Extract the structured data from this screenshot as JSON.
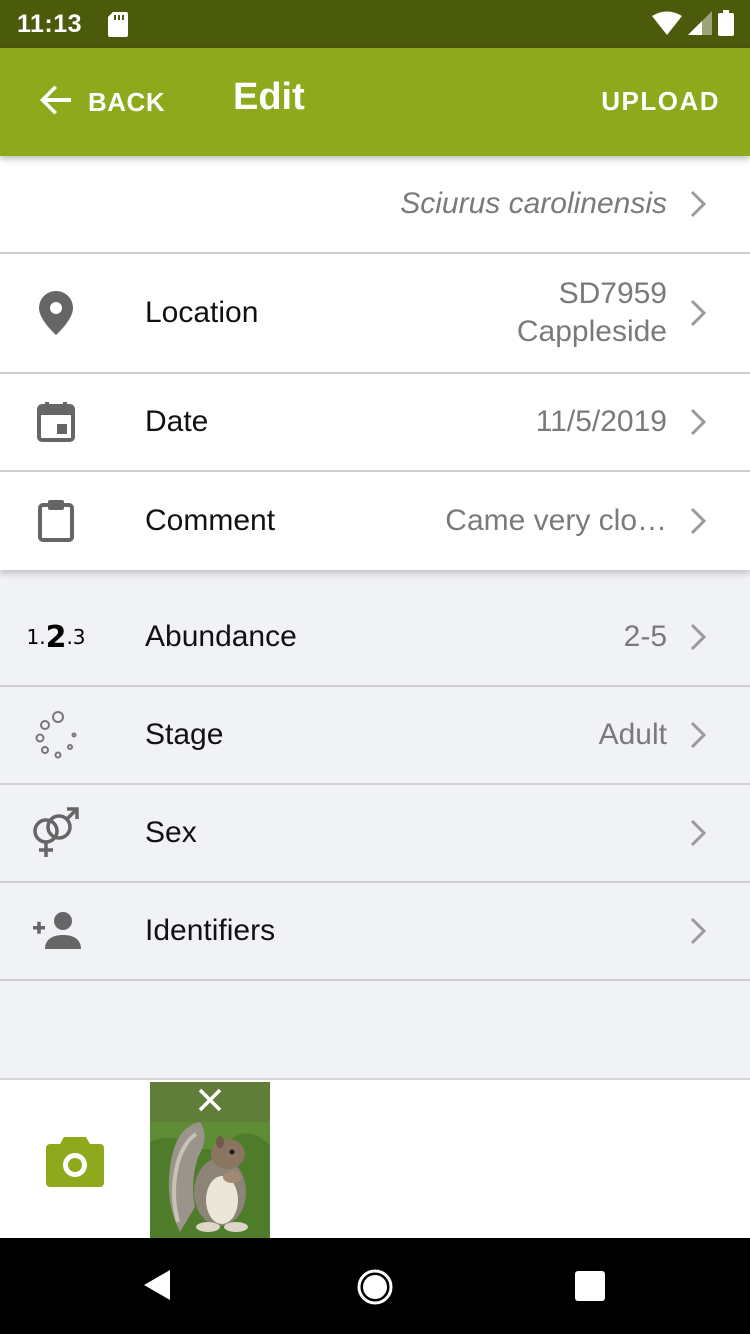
{
  "status_bar": {
    "time": "11:13",
    "icons": [
      "sd-card-icon",
      "wifi-icon",
      "signal-icon",
      "battery-icon"
    ]
  },
  "app_bar": {
    "back_label": "BACK",
    "title": "Edit",
    "upload_label": "UPLOAD",
    "color": "#8fa91c"
  },
  "record": {
    "species": "Sciurus carolinensis",
    "location": {
      "label": "Location",
      "value_line1": "SD7959",
      "value_line2": "Cappleside"
    },
    "date": {
      "label": "Date",
      "value": "11/5/2019"
    },
    "comment": {
      "label": "Comment",
      "value": "Came very clo…"
    }
  },
  "attributes": [
    {
      "label": "Abundance",
      "value": "2-5",
      "icon": "abundance-icon"
    },
    {
      "label": "Stage",
      "value": "Adult",
      "icon": "stage-icon"
    },
    {
      "label": "Sex",
      "value": "",
      "icon": "sex-icon"
    },
    {
      "label": "Identifiers",
      "value": "",
      "icon": "add-person-icon"
    }
  ],
  "abundance_icon_text": {
    "a": "1.",
    "b": "2",
    "c": ".3"
  },
  "photo_bar": {
    "camera_icon": "camera-icon",
    "photo_alt": "squirrel photo",
    "remove_icon": "close-icon"
  },
  "nav_bar": {
    "icons": [
      "back-triangle-icon",
      "home-circle-icon",
      "recents-square-icon"
    ]
  }
}
